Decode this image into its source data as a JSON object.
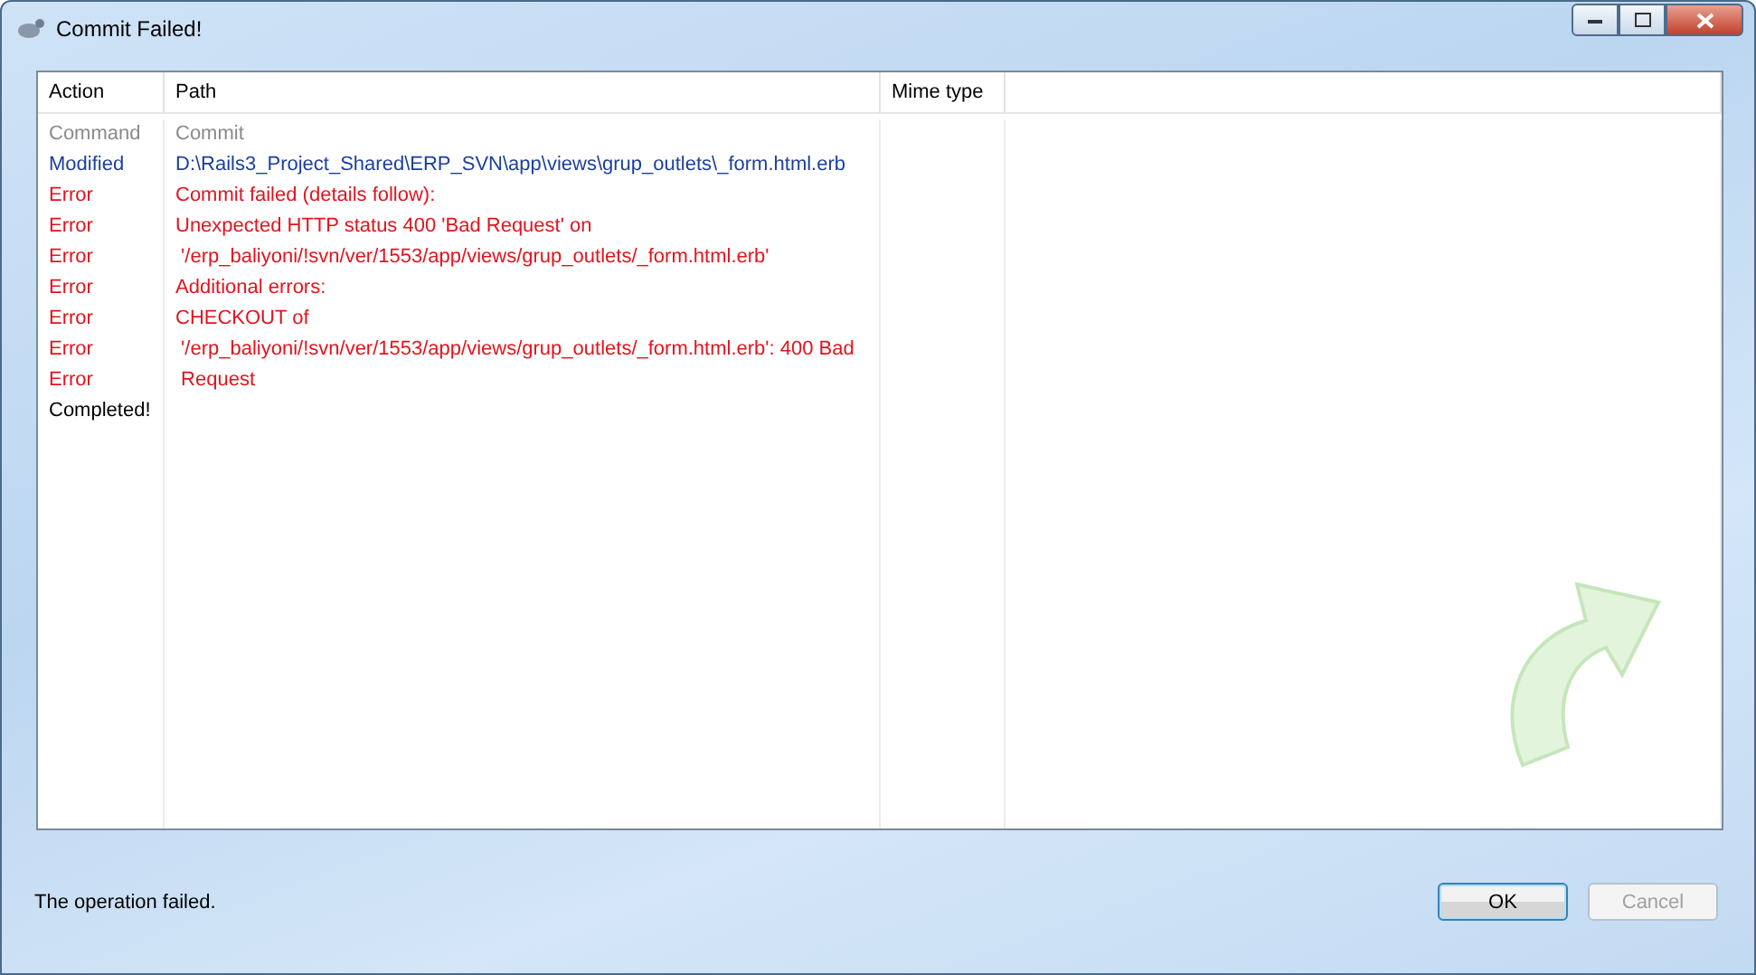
{
  "window": {
    "title": "Commit Failed!"
  },
  "table": {
    "columns": [
      "Action",
      "Path",
      "Mime type"
    ],
    "rows": [
      {
        "kind": "command",
        "action": "Command",
        "path": "Commit"
      },
      {
        "kind": "modified",
        "action": "Modified",
        "path": "D:\\Rails3_Project_Shared\\ERP_SVN\\app\\views\\grup_outlets\\_form.html.erb"
      },
      {
        "kind": "error",
        "action": "Error",
        "path": "Commit failed (details follow):"
      },
      {
        "kind": "error",
        "action": "Error",
        "path": "Unexpected HTTP status 400 'Bad Request' on"
      },
      {
        "kind": "error",
        "action": "Error",
        "path": " '/erp_baliyoni/!svn/ver/1553/app/views/grup_outlets/_form.html.erb'"
      },
      {
        "kind": "error",
        "action": "Error",
        "path": "Additional errors:"
      },
      {
        "kind": "error",
        "action": "Error",
        "path": "CHECKOUT of"
      },
      {
        "kind": "error",
        "action": "Error",
        "path": " '/erp_baliyoni/!svn/ver/1553/app/views/grup_outlets/_form.html.erb': 400 Bad"
      },
      {
        "kind": "error",
        "action": "Error",
        "path": " Request"
      },
      {
        "kind": "completed",
        "action": "Completed!"
      }
    ]
  },
  "status": "The operation failed.",
  "buttons": [
    {
      "label": "OK",
      "default": true,
      "disabled": false
    },
    {
      "label": "Cancel",
      "default": false,
      "disabled": true
    }
  ]
}
